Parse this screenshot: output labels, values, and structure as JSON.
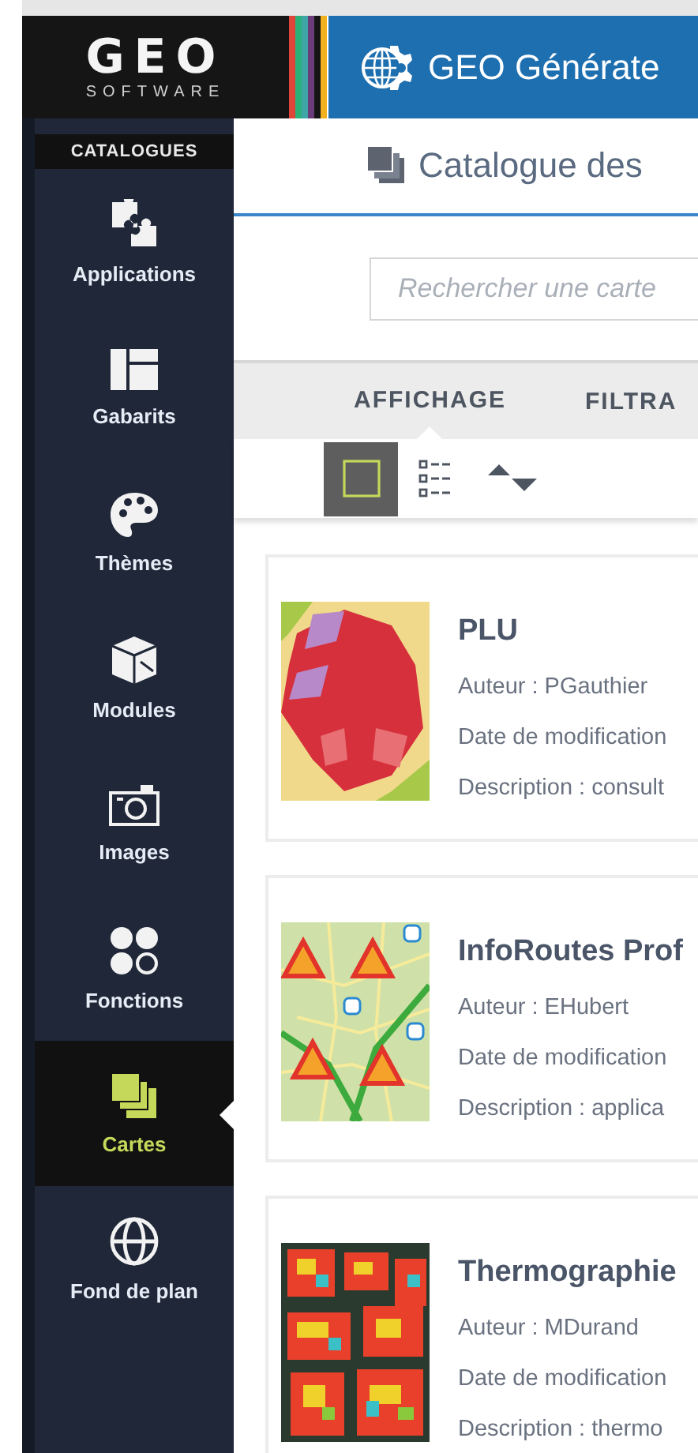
{
  "header": {
    "logo": {
      "wordmark": "GEO",
      "subtitle": "SOFTWARE"
    },
    "title": "GEO Générate"
  },
  "sidebar": {
    "heading": "CATALOGUES",
    "items": [
      {
        "label": "Applications",
        "kind": "puzzle",
        "selected": false
      },
      {
        "label": "Gabarits",
        "kind": "layout",
        "selected": false
      },
      {
        "label": "Thèmes",
        "kind": "palette",
        "selected": false
      },
      {
        "label": "Modules",
        "kind": "cube",
        "selected": false
      },
      {
        "label": "Images",
        "kind": "camera",
        "selected": false
      },
      {
        "label": "Fonctions",
        "kind": "circles",
        "selected": false
      },
      {
        "label": "Cartes",
        "kind": "stack",
        "selected": true
      },
      {
        "label": "Fond de plan",
        "kind": "globe",
        "selected": false
      }
    ]
  },
  "page_title": "Catalogue des",
  "search": {
    "placeholder": "Rechercher une carte"
  },
  "tabs": [
    {
      "label": "AFFICHAGE",
      "selected": true
    },
    {
      "label": "FILTRA",
      "selected": false
    }
  ],
  "view_buttons": [
    {
      "kind": "grid",
      "selected": true
    },
    {
      "kind": "list",
      "selected": false
    },
    {
      "kind": "sort",
      "selected": false
    }
  ],
  "cards": [
    {
      "title": "PLU",
      "author": "Auteur : PGauthier",
      "date": "Date de modification",
      "description": "Description : consult",
      "kind": "zoning"
    },
    {
      "title": "InfoRoutes Prof",
      "author": "Auteur : EHubert",
      "date": "Date de modification",
      "description": "Description : applica",
      "kind": "roadworks"
    },
    {
      "title": "Thermographie",
      "author": "Auteur : MDurand",
      "date": "Date de modification",
      "description": "Description : thermo",
      "kind": "thermal"
    }
  ]
}
